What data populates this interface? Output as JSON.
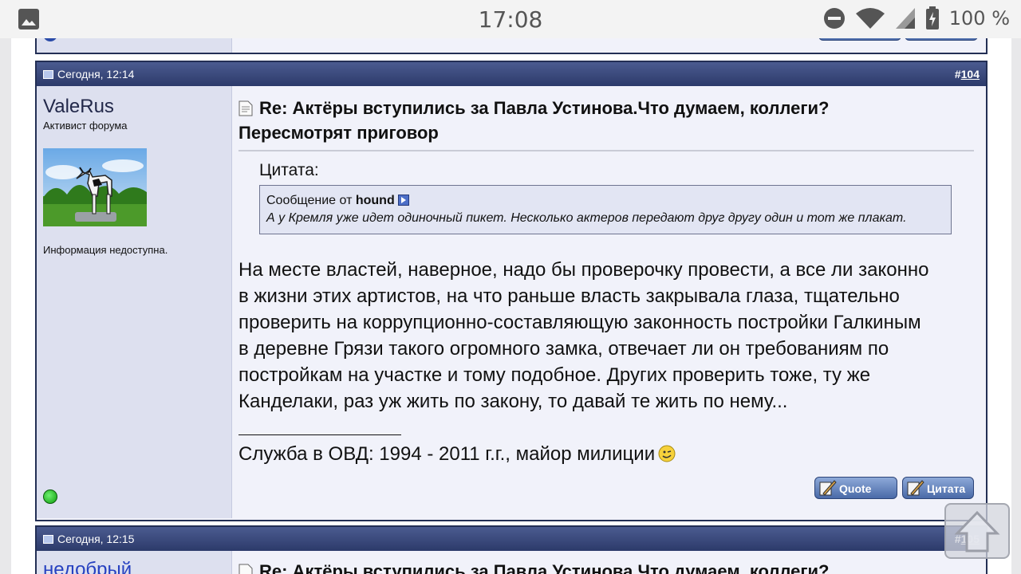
{
  "statusbar": {
    "time": "17:08",
    "battery": "100 %"
  },
  "prev_post": {},
  "post": {
    "date": "Сегодня, 12:14",
    "number_prefix": "#",
    "number": "104",
    "username": "ValeRus",
    "user_title": "Активист форума",
    "user_info": "Информация недоступна.",
    "title_line1": "Re: Актёры вступились за Павла Устинова.Что думаем, коллеги?",
    "title_line2": "Пересмотрят приговор",
    "quote_label": "Цитата:",
    "quote_from_prefix": "Сообщение от",
    "quote_author": "hound",
    "quote_text": "А у Кремля уже идет одиночный пикет. Несколько актеров передают друг другу один и тот же плакат.",
    "message_lines": [
      "На месте властей, наверное, надо бы проверочку провести, а все ли законно",
      "в жизни этих артистов, на что раньше власть закрывала глаза, тщательно",
      "проверить на коррупционно-составляющую законность постройки Галкиным",
      "в деревне Грязи такого огромного замка, отвечает ли он требованиям по",
      "постройкам на участке и тому подобное. Других проверить тоже, ту же",
      "Канделаки, раз уж жить по закону, то давай те жить по нему..."
    ],
    "signature_line": "_________________",
    "signature": "Служба в ОВД: 1994 - 2011 г.г., майор милиции",
    "buttons": {
      "quick_quote": "Quote",
      "quote": "Цитата"
    }
  },
  "next_post": {
    "date": "Сегодня, 12:15",
    "number_prefix": "#",
    "number": "105",
    "username": "недобрый",
    "title_line1": "Re: Актёры вступились за Павла Устинова.Что думаем, коллеги?"
  },
  "colors": {
    "header": "#2c3a6a",
    "side_bg": "#dde0ef",
    "post_bg": "#f1f2fa"
  }
}
